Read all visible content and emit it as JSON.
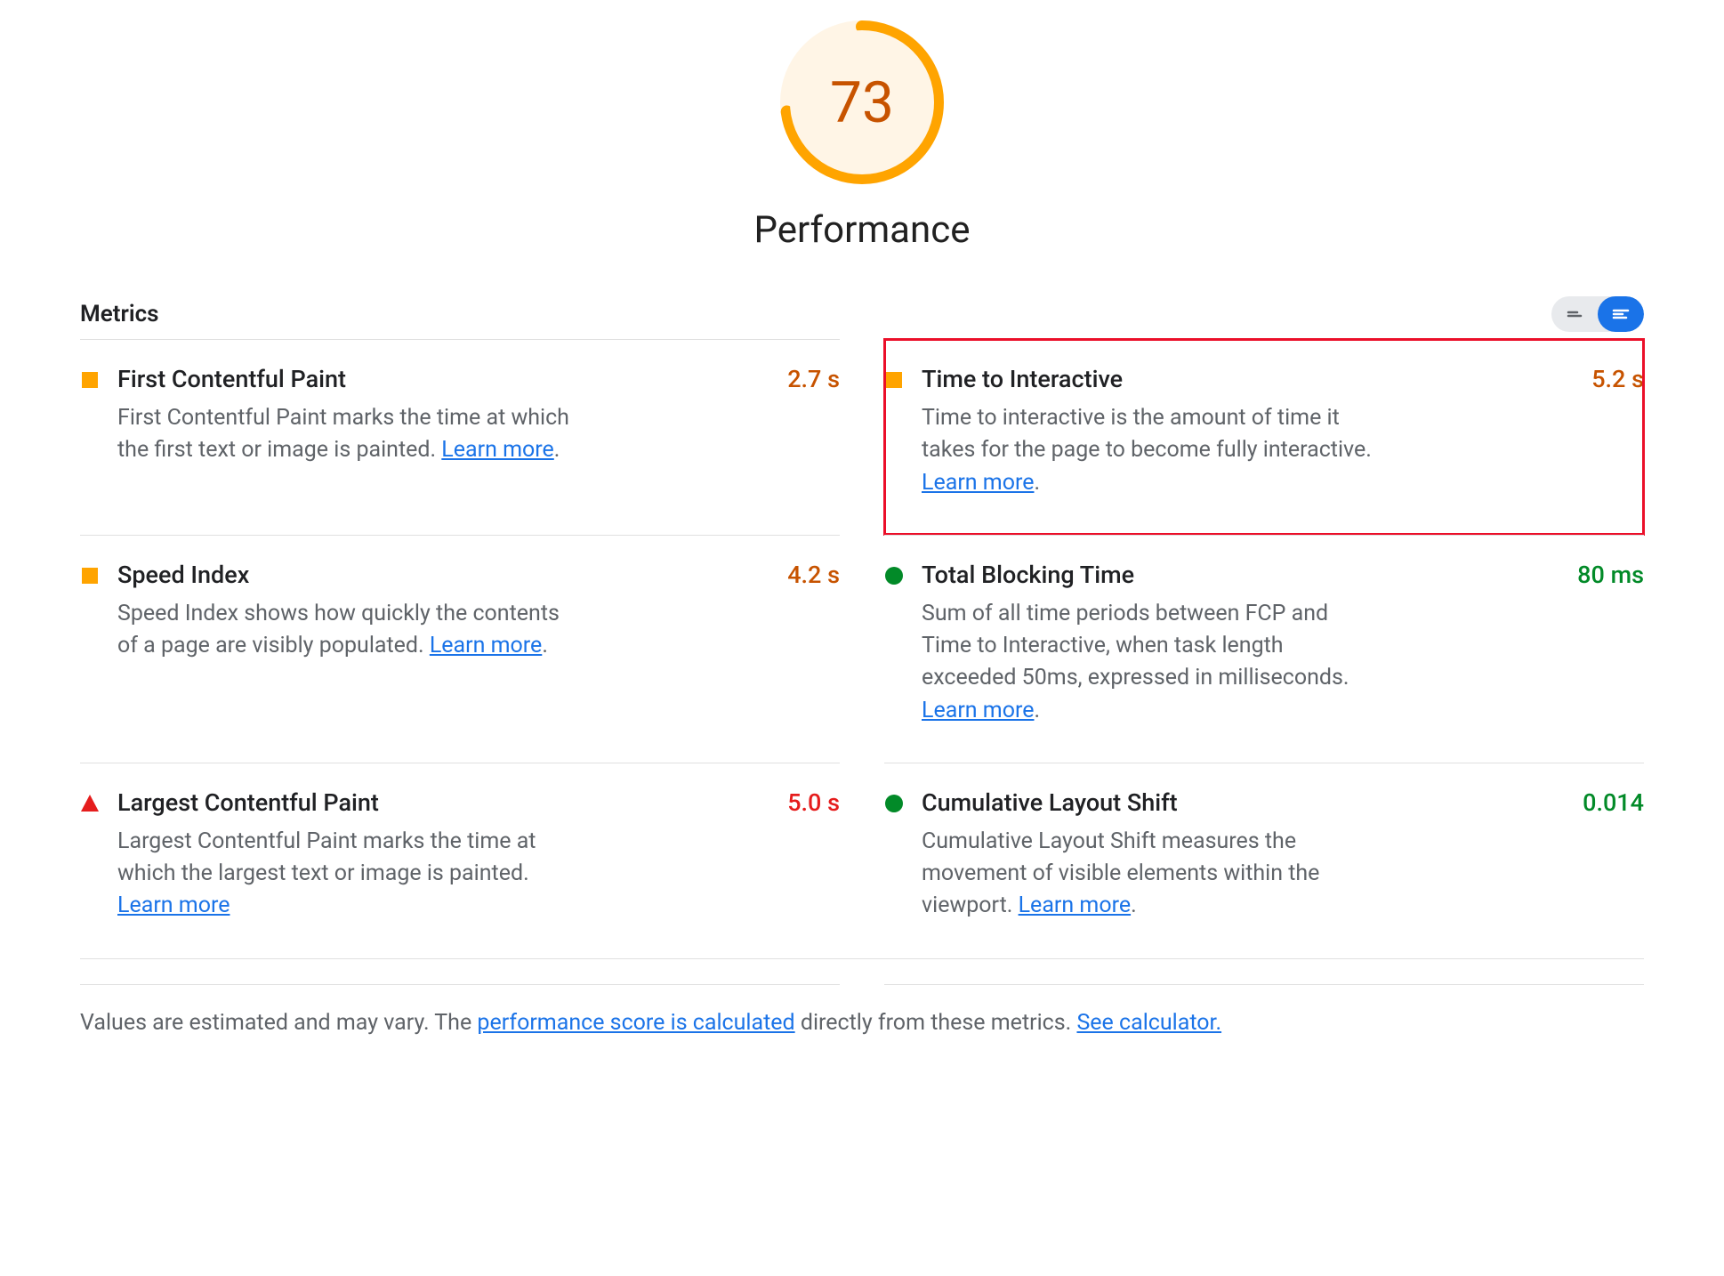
{
  "gauge": {
    "score": "73",
    "title": "Performance",
    "percent": 73,
    "color": "#FFA400",
    "score_color": "#C75300"
  },
  "metrics_header": "Metrics",
  "learn_more_label": "Learn more",
  "metrics": [
    {
      "id": "fcp",
      "name": "First Contentful Paint",
      "value": "2.7 s",
      "status": "average",
      "desc_pre": "First Contentful Paint marks the time at which the first text or image is painted. ",
      "desc_post": ".",
      "highlight": false
    },
    {
      "id": "tti",
      "name": "Time to Interactive",
      "value": "5.2 s",
      "status": "average",
      "desc_pre": "Time to interactive is the amount of time it takes for the page to become fully interactive. ",
      "desc_post": ".",
      "highlight": true
    },
    {
      "id": "si",
      "name": "Speed Index",
      "value": "4.2 s",
      "status": "average",
      "desc_pre": "Speed Index shows how quickly the contents of a page are visibly populated. ",
      "desc_post": ".",
      "highlight": false
    },
    {
      "id": "tbt",
      "name": "Total Blocking Time",
      "value": "80 ms",
      "status": "pass",
      "desc_pre": "Sum of all time periods between FCP and Time to Interactive, when task length exceeded 50ms, expressed in milliseconds. ",
      "desc_post": ".",
      "highlight": false
    },
    {
      "id": "lcp",
      "name": "Largest Contentful Paint",
      "value": "5.0 s",
      "status": "fail",
      "desc_pre": "Largest Contentful Paint marks the time at which the largest text or image is painted. ",
      "desc_post": "",
      "highlight": false
    },
    {
      "id": "cls",
      "name": "Cumulative Layout Shift",
      "value": "0.014",
      "status": "pass",
      "desc_pre": "Cumulative Layout Shift measures the movement of visible elements within the viewport. ",
      "desc_post": ".",
      "highlight": false
    }
  ],
  "footer": {
    "text_pre": "Values are estimated and may vary. The ",
    "calc_link": "performance score is calculated",
    "text_mid": " directly from these metrics. ",
    "see_calc": "See calculator."
  }
}
